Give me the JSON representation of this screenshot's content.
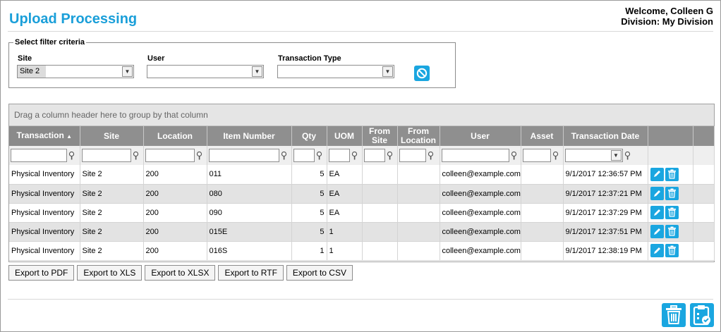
{
  "header": {
    "title": "Upload Processing",
    "welcome": "Welcome, Colleen G",
    "division": "Division: My Division"
  },
  "filters": {
    "legend": "Select filter criteria",
    "site_label": "Site",
    "site_value": "Site 2",
    "user_label": "User",
    "user_value": "",
    "transaction_type_label": "Transaction Type",
    "transaction_type_value": ""
  },
  "grid": {
    "group_panel": "Drag a column header here to group by that column",
    "sort_indicator": "▲",
    "columns": [
      "Transaction",
      "Site",
      "Location",
      "Item Number",
      "Qty",
      "UOM",
      "From Site",
      "From Location",
      "User",
      "Asset",
      "Transaction Date"
    ],
    "rows": [
      [
        "Physical Inventory",
        "Site 2",
        "200",
        "011",
        "5",
        "EA",
        "",
        "",
        "colleen@example.com",
        "",
        "9/1/2017 12:36:57 PM"
      ],
      [
        "Physical Inventory",
        "Site 2",
        "200",
        "080",
        "5",
        "EA",
        "",
        "",
        "colleen@example.com",
        "",
        "9/1/2017 12:37:21 PM"
      ],
      [
        "Physical Inventory",
        "Site 2",
        "200",
        "090",
        "5",
        "EA",
        "",
        "",
        "colleen@example.com",
        "",
        "9/1/2017 12:37:29 PM"
      ],
      [
        "Physical Inventory",
        "Site 2",
        "200",
        "015E",
        "5",
        "1",
        "",
        "",
        "colleen@example.com",
        "",
        "9/1/2017 12:37:51 PM"
      ],
      [
        "Physical Inventory",
        "Site 2",
        "200",
        "016S",
        "1",
        "1",
        "",
        "",
        "colleen@example.com",
        "",
        "9/1/2017 12:38:19 PM"
      ]
    ]
  },
  "exports": [
    "Export to PDF",
    "Export to XLS",
    "Export to XLSX",
    "Export to RTF",
    "Export to CSV"
  ],
  "icons": {
    "clear_filter": "clear-filter-icon",
    "row_edit": "pencil-icon",
    "row_delete": "trash-icon",
    "bulk_delete": "trash-icon",
    "process": "clipboard-check-icon"
  },
  "colors": {
    "accent": "#1aa6e0",
    "title": "#1a9fd9",
    "header_bg": "#8f8f8f",
    "alt_row": "#e3e3e3"
  }
}
